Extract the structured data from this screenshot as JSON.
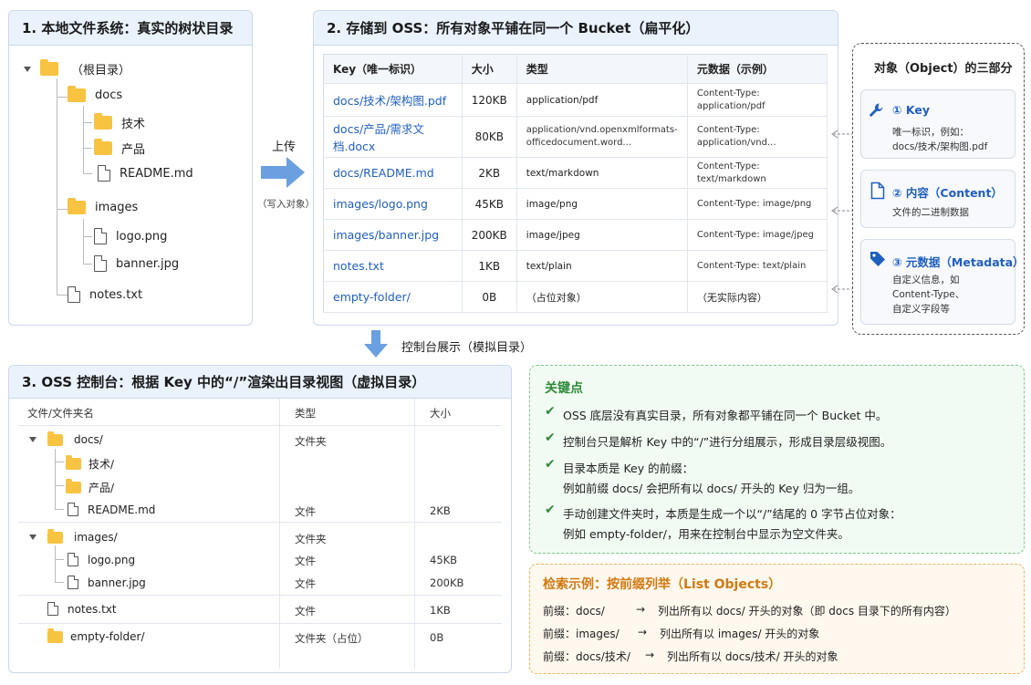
{
  "panel1": {
    "title": "1. 本地文件系统：真实的树状目录",
    "root": "（根目录）",
    "docs": "docs",
    "tech": "技术",
    "product": "产品",
    "readme": "README.md",
    "images": "images",
    "logo": "logo.png",
    "banner": "banner.jpg",
    "notes": "notes.txt"
  },
  "upload": {
    "label": "上传",
    "sub": "（写入对象）"
  },
  "panel2": {
    "title": "2. 存储到 OSS：所有对象平铺在同一个 Bucket（扁平化）",
    "headers": [
      "Key（唯一标识）",
      "大小",
      "类型",
      "元数据（示例）"
    ],
    "rows": [
      {
        "key": "docs/技术/架构图.pdf",
        "size": "120KB",
        "type": "application/pdf",
        "meta": "Content-Type: application/pdf"
      },
      {
        "key": "docs/产品/需求文档.docx",
        "size": "80KB",
        "type": "application/vnd.openxmlformats-officedocument.word...",
        "meta": "Content-Type: application/vnd..."
      },
      {
        "key": "docs/README.md",
        "size": "2KB",
        "type": "text/markdown",
        "meta": "Content-Type: text/markdown"
      },
      {
        "key": "images/logo.png",
        "size": "45KB",
        "type": "image/png",
        "meta": "Content-Type: image/png"
      },
      {
        "key": "images/banner.jpg",
        "size": "200KB",
        "type": "image/jpeg",
        "meta": "Content-Type: image/jpeg"
      },
      {
        "key": "notes.txt",
        "size": "1KB",
        "type": "text/plain",
        "meta": "Content-Type: text/plain"
      },
      {
        "key": "empty-folder/",
        "size": "0B",
        "type": "（占位对象）",
        "meta": "（无实际内容）"
      }
    ]
  },
  "parts": {
    "title": "对象（Object）的三部分",
    "key_title": "① Key",
    "key_desc1": "唯一标识，例如：",
    "key_desc2": "docs/技术/架构图.pdf",
    "content_title": "② 内容（Content）",
    "content_desc": "文件的二进制数据",
    "meta_title": "③ 元数据（Metadata）",
    "meta_desc1": "自定义信息，如",
    "meta_desc2": "Content-Type、",
    "meta_desc3": "自定义字段等"
  },
  "console_arrow": "控制台展示（模拟目录）",
  "panel3": {
    "title": "3.  OSS 控制台：根据 Key 中的“/”渲染出目录视图（虚拟目录）",
    "headers": [
      "文件/文件夹名",
      "类型",
      "大小"
    ],
    "docs": "docs/",
    "tech": "技术/",
    "product": "产品/",
    "readme": "README.md",
    "images": "images/",
    "logo": "logo.png",
    "banner": "banner.jpg",
    "notes": "notes.txt",
    "empty": "empty-folder/",
    "type_folder": "文件夹",
    "type_file": "文件",
    "type_placeholder": "文件夹（占位）",
    "size_readme": "2KB",
    "size_logo": "45KB",
    "size_banner": "200KB",
    "size_notes": "1KB",
    "size_empty": "0B"
  },
  "keypoints": {
    "title": "关键点",
    "p1": "OSS 底层没有真实目录，所有对象都平铺在同一个 Bucket 中。",
    "p2": "控制台只是解析 Key 中的“/”进行分组展示，形成目录层级视图。",
    "p3a": "目录本质是 Key 的前缀：",
    "p3b": "例如前缀 docs/ 会把所有以 docs/ 开头的 Key 归为一组。",
    "p4a": "手动创建文件夹时，本质是生成一个以“/”结尾的 0 字节占位对象：",
    "p4b": "例如 empty-folder/，用来在控制台中显示为空文件夹。"
  },
  "search": {
    "title": "检索示例：按前缀列举（List Objects）",
    "l1_prefix": "前缀：docs/",
    "l1_desc": "列出所有以 docs/ 开头的对象（即 docs 目录下的所有内容）",
    "l2_prefix": "前缀：images/",
    "l2_desc": "列出所有以 images/ 开头的对象",
    "l3_prefix": "前缀：docs/技术/",
    "l3_desc": "列出所有以 docs/技术/ 开头的对象",
    "arrow": "→"
  },
  "colors": {
    "panel_header": "#eaf2fc",
    "link_blue": "#1f5fbf",
    "arrow_blue": "#6aa0e0",
    "folder_yellow": "#f7c341",
    "green": "#2e8b3a",
    "orange": "#d07a12"
  }
}
